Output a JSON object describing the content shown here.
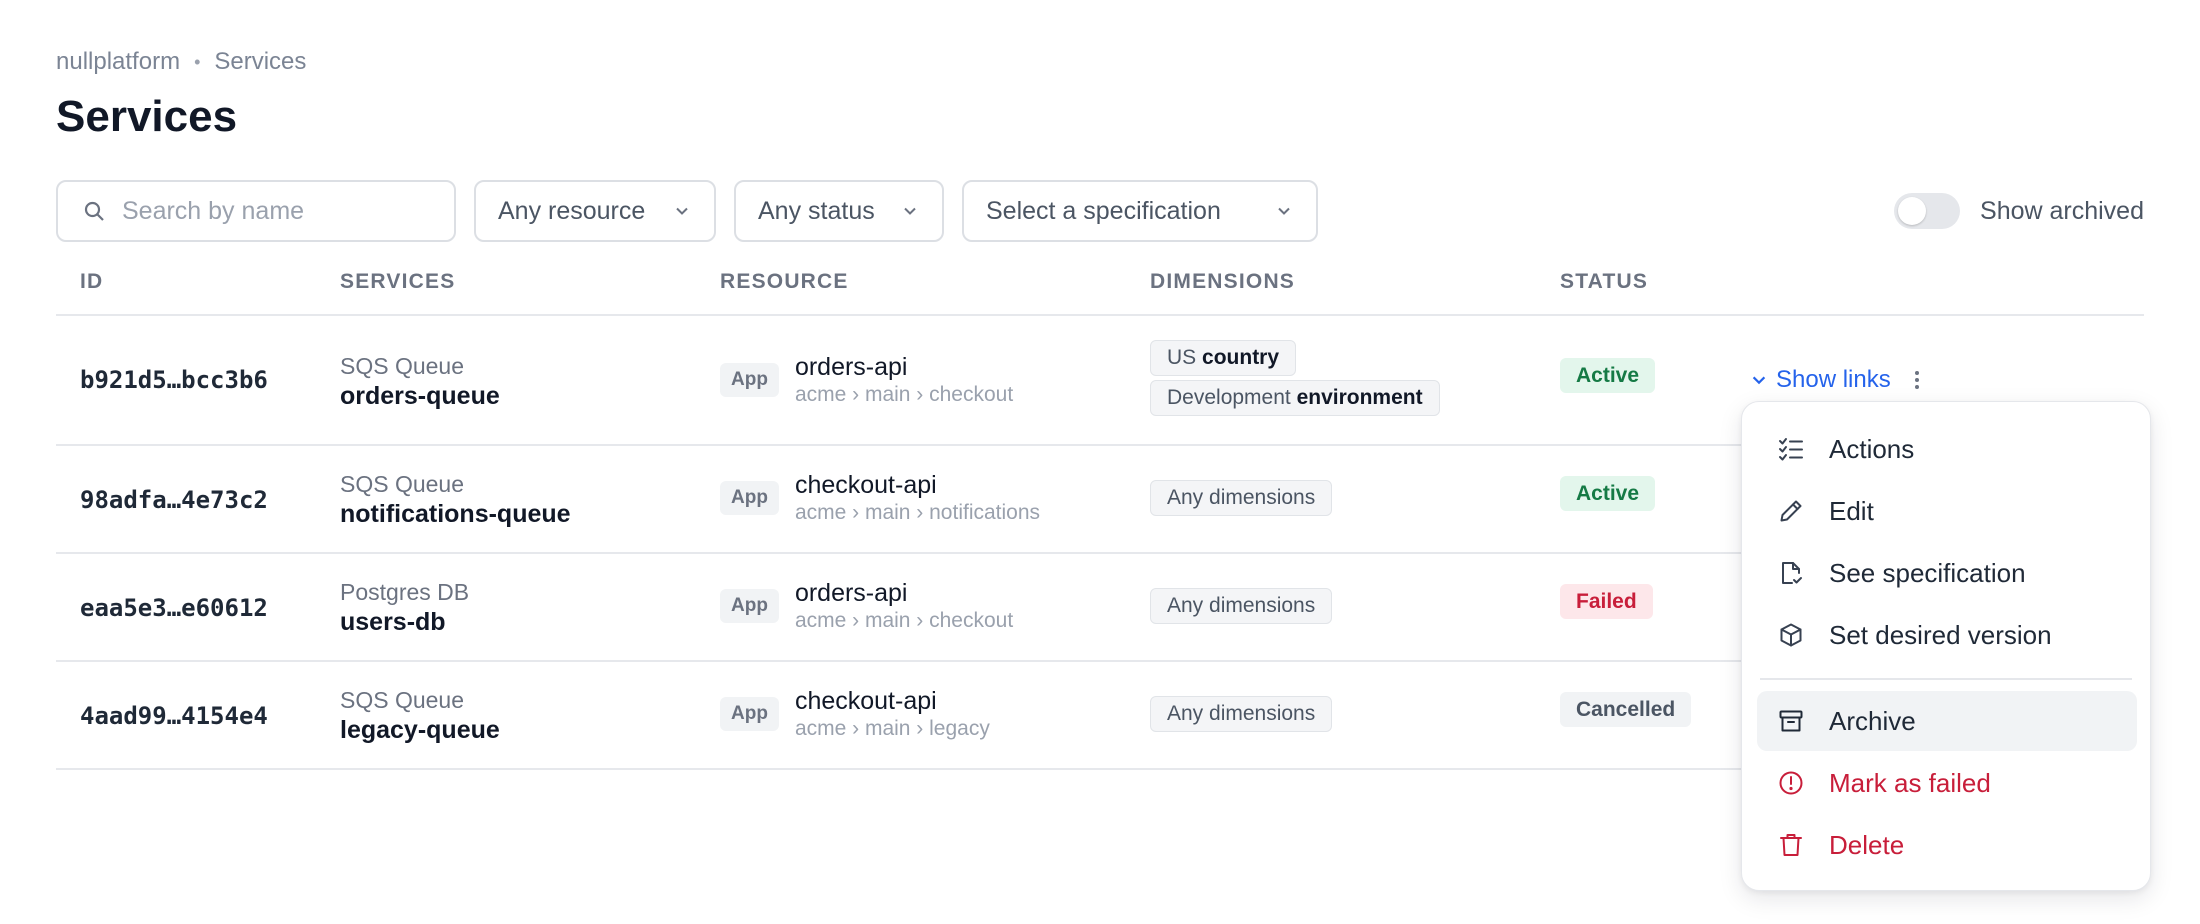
{
  "breadcrumb": {
    "org": "nullplatform",
    "current": "Services"
  },
  "page": {
    "title": "Services"
  },
  "filters": {
    "search_placeholder": "Search by name",
    "resource": "Any resource",
    "status": "Any status",
    "specification": "Select a specification",
    "show_archived_label": "Show archived",
    "show_archived": false
  },
  "table": {
    "headers": [
      "ID",
      "SERVICES",
      "RESOURCE",
      "DIMENSIONS",
      "STATUS"
    ],
    "rows": [
      {
        "id": "b921d5…bcc3b6",
        "service_type": "SQS Queue",
        "service_name": "orders-queue",
        "resource_tag": "App",
        "resource_name": "orders-api",
        "resource_path": "acme › main › checkout",
        "dimensions": [
          {
            "value": "US",
            "key": "country"
          },
          {
            "value": "Development",
            "key": "environment"
          }
        ],
        "status": "Active",
        "links_label": "Show links"
      },
      {
        "id": "98adfa…4e73c2",
        "service_type": "SQS Queue",
        "service_name": "notifications-queue",
        "resource_tag": "App",
        "resource_name": "checkout-api",
        "resource_path": "acme › main › notifications",
        "dimensions_text": "Any dimensions",
        "status": "Active"
      },
      {
        "id": "eaa5e3…e60612",
        "service_type": "Postgres DB",
        "service_name": "users-db",
        "resource_tag": "App",
        "resource_name": "orders-api",
        "resource_path": "acme › main › checkout",
        "dimensions_text": "Any dimensions",
        "status": "Failed"
      },
      {
        "id": "4aad99…4154e4",
        "service_type": "SQS Queue",
        "service_name": "legacy-queue",
        "resource_tag": "App",
        "resource_name": "checkout-api",
        "resource_path": "acme › main › legacy",
        "dimensions_text": "Any dimensions",
        "status": "Cancelled"
      }
    ]
  },
  "menu": {
    "items": [
      {
        "label": "Actions",
        "icon": "list-checks-icon"
      },
      {
        "label": "Edit",
        "icon": "pencil-icon"
      },
      {
        "label": "See specification",
        "icon": "file-spec-icon"
      },
      {
        "label": "Set desired version",
        "icon": "box-icon"
      },
      {
        "label": "Archive",
        "icon": "archive-icon",
        "highlighted": true
      },
      {
        "label": "Mark as failed",
        "icon": "alert-circle-icon",
        "danger": true
      },
      {
        "label": "Delete",
        "icon": "trash-icon",
        "danger": true
      }
    ]
  },
  "colors": {
    "accent": "#2563eb",
    "danger": "#c81e3a",
    "success": "#157a45",
    "text": "#111827",
    "muted": "#6b7280"
  }
}
